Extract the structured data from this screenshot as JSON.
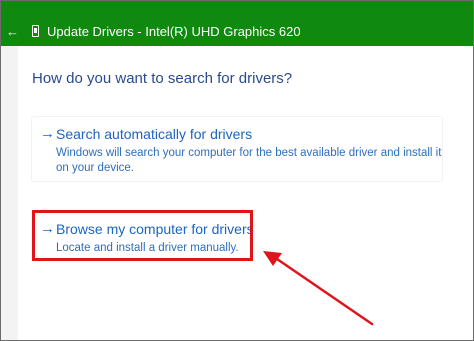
{
  "window": {
    "title": "Update Drivers - Intel(R) UHD Graphics 620",
    "back_glyph": "←"
  },
  "dialog": {
    "heading": "How do you want to search for drivers?",
    "options": [
      {
        "arrow": "→",
        "title": "Search automatically for drivers",
        "description": "Windows will search your computer for the best available driver and install it on your device."
      },
      {
        "arrow": "→",
        "title": "Browse my computer for drivers",
        "description": "Locate and install a driver manually."
      }
    ]
  },
  "colors": {
    "titlebar": "#0f8a0f",
    "link": "#1b65c4",
    "annotation": "#e0141c"
  },
  "icons": {
    "back": "back-arrow-icon",
    "device": "display-adapter-icon",
    "option_arrow": "chevron-right-arrow-icon"
  }
}
